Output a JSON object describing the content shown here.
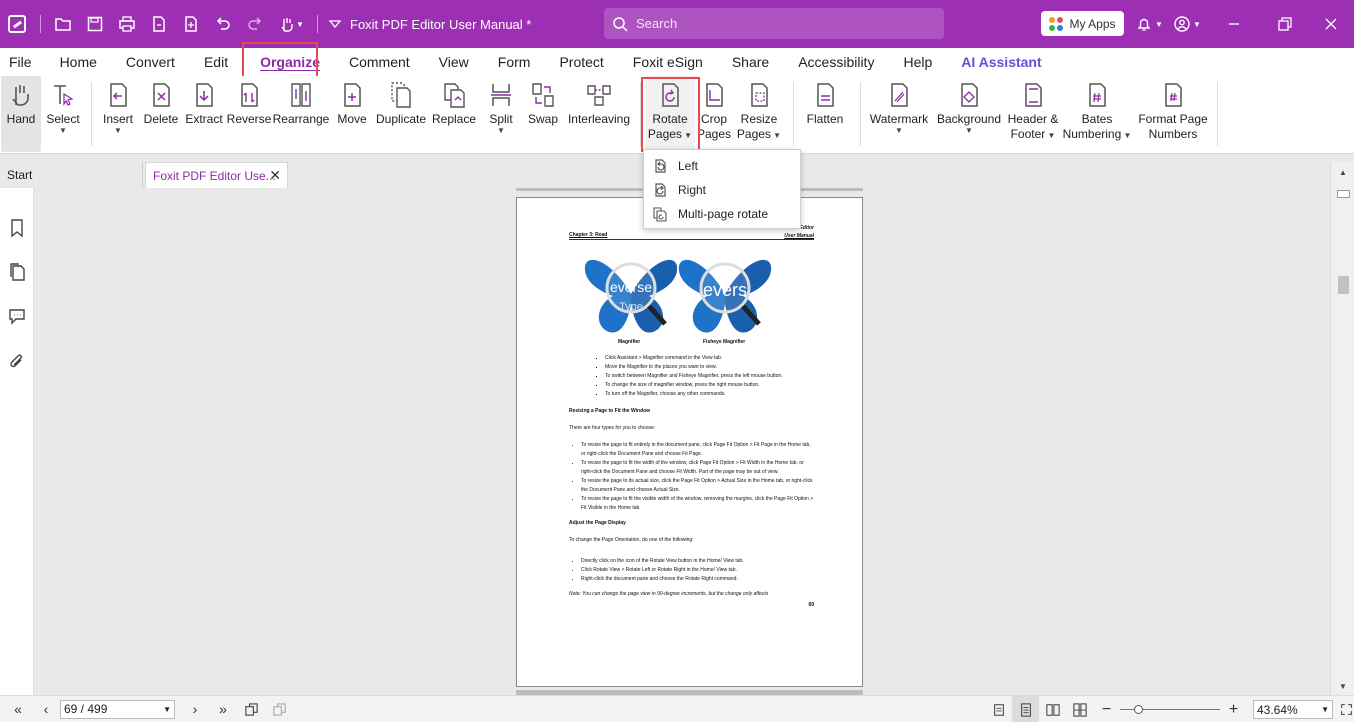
{
  "titlebar": {
    "doc_title": "Foxit PDF Editor User Manual *",
    "search_placeholder": "Search",
    "myapps_label": "My Apps",
    "colors": {
      "bar": "#9c2fb3"
    }
  },
  "menu": {
    "items": [
      "File",
      "Home",
      "Convert",
      "Edit",
      "Organize",
      "Comment",
      "View",
      "Form",
      "Protect",
      "Foxit eSign",
      "Share",
      "Accessibility",
      "Help",
      "AI Assistant"
    ],
    "active": "Organize"
  },
  "ribbon": {
    "hand": "Hand",
    "select": "Select",
    "insert": "Insert",
    "delete": "Delete",
    "extract": "Extract",
    "reverse": "Reverse",
    "rearrange": "Rearrange",
    "move": "Move",
    "duplicate": "Duplicate",
    "replace": "Replace",
    "split": "Split",
    "swap": "Swap",
    "interleaving": "Interleaving",
    "rotate_1": "Rotate",
    "rotate_2": "Pages",
    "crop_1": "Crop",
    "crop_2": "Pages",
    "resize_1": "Resize",
    "resize_2": "Pages",
    "flatten": "Flatten",
    "watermark": "Watermark",
    "background": "Background",
    "header_1": "Header &",
    "header_2": "Footer",
    "bates_1": "Bates",
    "bates_2": "Numbering",
    "format_1": "Format Page",
    "format_2": "Numbers"
  },
  "rotate_menu": {
    "left": "Left",
    "right": "Right",
    "multi": "Multi-page rotate"
  },
  "tabs": {
    "start": "Start",
    "doc": "Foxit PDF Editor Use..."
  },
  "page": {
    "header_left": "Chapter 3: Read",
    "header_right_1": "Editor",
    "header_right_2": "User Manual",
    "caption_1": "Magnifier",
    "caption_2": "Fisheye Magnifier",
    "bfly_text_1": "everse",
    "bfly_text_1b": "Type",
    "bfly_text_2": "evers",
    "bullets_1": [
      "Click Assistant > Magnifier command in the View tab.",
      "Move the Magnifier to the places you want to view.",
      "To switch between Magnifier and Fisheye Magnifier, press the left mouse button.",
      "To change the size of magnifier window, press the right mouse button.",
      "To turn off the Magnifier, choose any other commands."
    ],
    "heading_resize": "Resizing a Page to Fit the Window",
    "intro_resize": "There are four types for you to choose:",
    "bullets_2": [
      "To resize the page to fit entirely in the document pane, click Page Fit Option > Fit Page in the Home tab, or right-click the Document Pane and choose Fit Page.",
      "To resize the page to fit the width of the window, click Page Fit Option > Fit Width in the Home tab, or right-click the Document Pane and choose Fit Width. Part of the page may be out of view.",
      "To resize the page to its actual size, click the Page Fit Option > Actual Size in the Home tab, or right-click the Document Pane and choose Actual Size.",
      "To resize the page to fit the visible width of the window, removing the margins, click the Page Fit Option > Fit Visible in the Home tab."
    ],
    "heading_adjust": "Adjust the Page Display",
    "intro_adjust": "To change the Page Orientation, do one of the following:",
    "bullets_3": [
      "Directly click on the      icon of the Rotate View button in the Home/ View tab.",
      "Click Rotate View > Rotate Left or Rotate Right in the Home/ View tab.",
      "Right-click the document pane and choose the Rotate Right command."
    ],
    "note": "Note: You can change the page view in 90-degree increments, but the change only affects",
    "page_number": "69"
  },
  "status": {
    "page_field": "69 / 499",
    "zoom": "43.64%",
    "zoom_level": 0.15
  }
}
